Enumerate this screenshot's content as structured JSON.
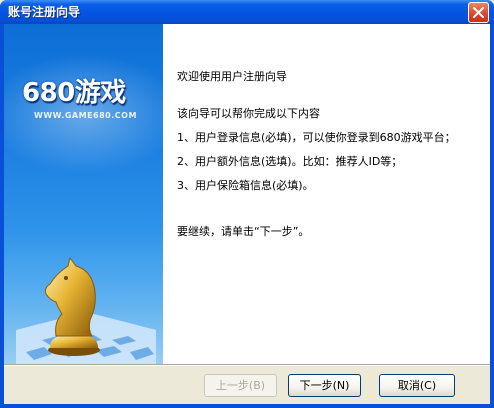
{
  "window": {
    "title": "账号注册向导"
  },
  "banner": {
    "brand_title": "680游戏",
    "brand_url": "WWW.GAME680.COM"
  },
  "content": {
    "welcome": "欢迎使用用户注册向导",
    "intro": "该向导可以帮你完成以下内容",
    "step1": "1、用户登录信息(必填)，可以使你登录到680游戏平台；",
    "step2": "2、用户额外信息(选填)。比如：推荐人ID等；",
    "step3": "3、用户保险箱信息(必填)。",
    "continue_hint": "要继续，请单击“下一步”。"
  },
  "buttons": {
    "back": "上一步(B)",
    "next": "下一步(N)",
    "cancel": "取消(C)"
  },
  "colors": {
    "titlebar": "#0553e1",
    "banner_top": "#0d6fd6",
    "banner_bottom": "#98cdf5",
    "dialog_bg": "#ece9d8"
  }
}
